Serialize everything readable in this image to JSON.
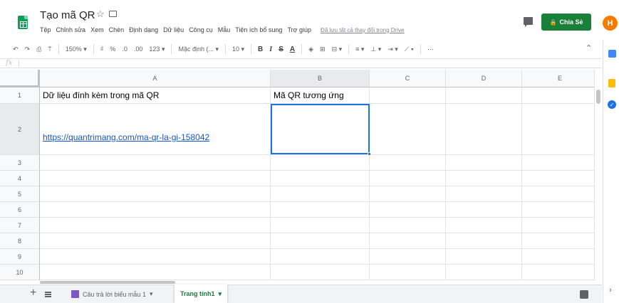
{
  "app": {
    "title": "Tạo mã QR",
    "star_glyph": "☆",
    "menu": [
      "Tệp",
      "Chỉnh sửa",
      "Xem",
      "Chèn",
      "Định dạng",
      "Dữ liệu",
      "Công cụ",
      "Mẫu",
      "Tiện ích bổ sung",
      "Trợ giúp"
    ],
    "save_status": "Đã lưu tất cả thay đổi trong Drive",
    "share_label": "Chia Sẻ",
    "avatar_initial": "H"
  },
  "toolbar": {
    "undo": "↶",
    "redo": "↷",
    "print": "⎙",
    "paint_format": "⍑",
    "zoom": "150% ▾",
    "currency": "₫",
    "percent": "%",
    "dec_decrease": ".0",
    "dec_increase": ".00",
    "number_format": "123 ▾",
    "font": "Mặc định (... ▾",
    "font_size": "10 ▾",
    "bold": "B",
    "italic": "I",
    "strike": "S",
    "text_color": "A",
    "fill": "◈",
    "borders": "⊞",
    "merge": "⊟ ▾",
    "h_align": "≡ ▾",
    "v_align": "⊥ ▾",
    "wrap": "⇥ ▾",
    "rotate": "⟋ ▾",
    "more": "⋯",
    "collapse": "⌃"
  },
  "formula_bar": {
    "fx": "fx",
    "value": ""
  },
  "grid": {
    "columns": [
      "A",
      "B",
      "C",
      "D",
      "E"
    ],
    "rows": [
      "1",
      "2",
      "3",
      "4",
      "5",
      "6",
      "7",
      "8",
      "9",
      "10"
    ],
    "cells": {
      "A1": "Dữ liệu đính kèm trong mã QR",
      "B1": "Mã QR tương ứng",
      "A2": "https://quantrimang.com/ma-qr-la-gi-158042"
    }
  },
  "sheets": {
    "add": "+",
    "tabs": [
      {
        "label": "Câu trả lời biểu mẫu 1",
        "arrow": "▾"
      },
      {
        "label": "Trang tính1",
        "arrow": "▾"
      }
    ]
  },
  "side_panel": {
    "tasks_glyph": "✓",
    "expand": "›"
  },
  "colors": {
    "brand_green": "#188038",
    "selection_blue": "#1a73e8",
    "link": "#1155cc",
    "avatar": "#f57c00"
  }
}
